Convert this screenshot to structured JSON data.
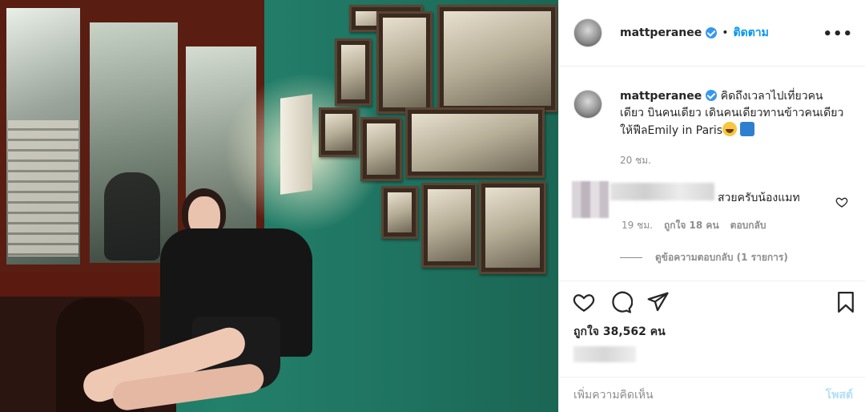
{
  "post": {
    "username": "matt​peranee",
    "follow_label": "ติดตาม",
    "separator": "•",
    "more_label": "•••"
  },
  "caption": {
    "username": "matt​peranee",
    "text": "คิดถึงเวลาไปเที่ยวคนเดียว บินคนเดียว เดินคนเดียวทานข้าวคนเดียว ให้ฟีลEmily in Paris",
    "time": "20 ชม."
  },
  "comment": {
    "text": "สวยครับน้องแมท",
    "time": "19 ชม.",
    "likes": "ถูกใจ 18 คน",
    "reply_label": "ตอบกลับ",
    "view_replies": "ดูข้อความตอบกลับ (1 รายการ)"
  },
  "stats": {
    "likes": "ถูกใจ 38,562 คน"
  },
  "composer": {
    "placeholder": "เพิ่มความคิดเห็น",
    "post_label": "โพสต์"
  },
  "colors": {
    "accent": "#0095f6",
    "verified": "#3897f0",
    "muted": "#8e8e8e",
    "post_disabled": "#b2dffc"
  },
  "icons": [
    "heart-icon",
    "comment-icon",
    "share-icon",
    "bookmark-icon",
    "verified-icon",
    "more-icon"
  ]
}
